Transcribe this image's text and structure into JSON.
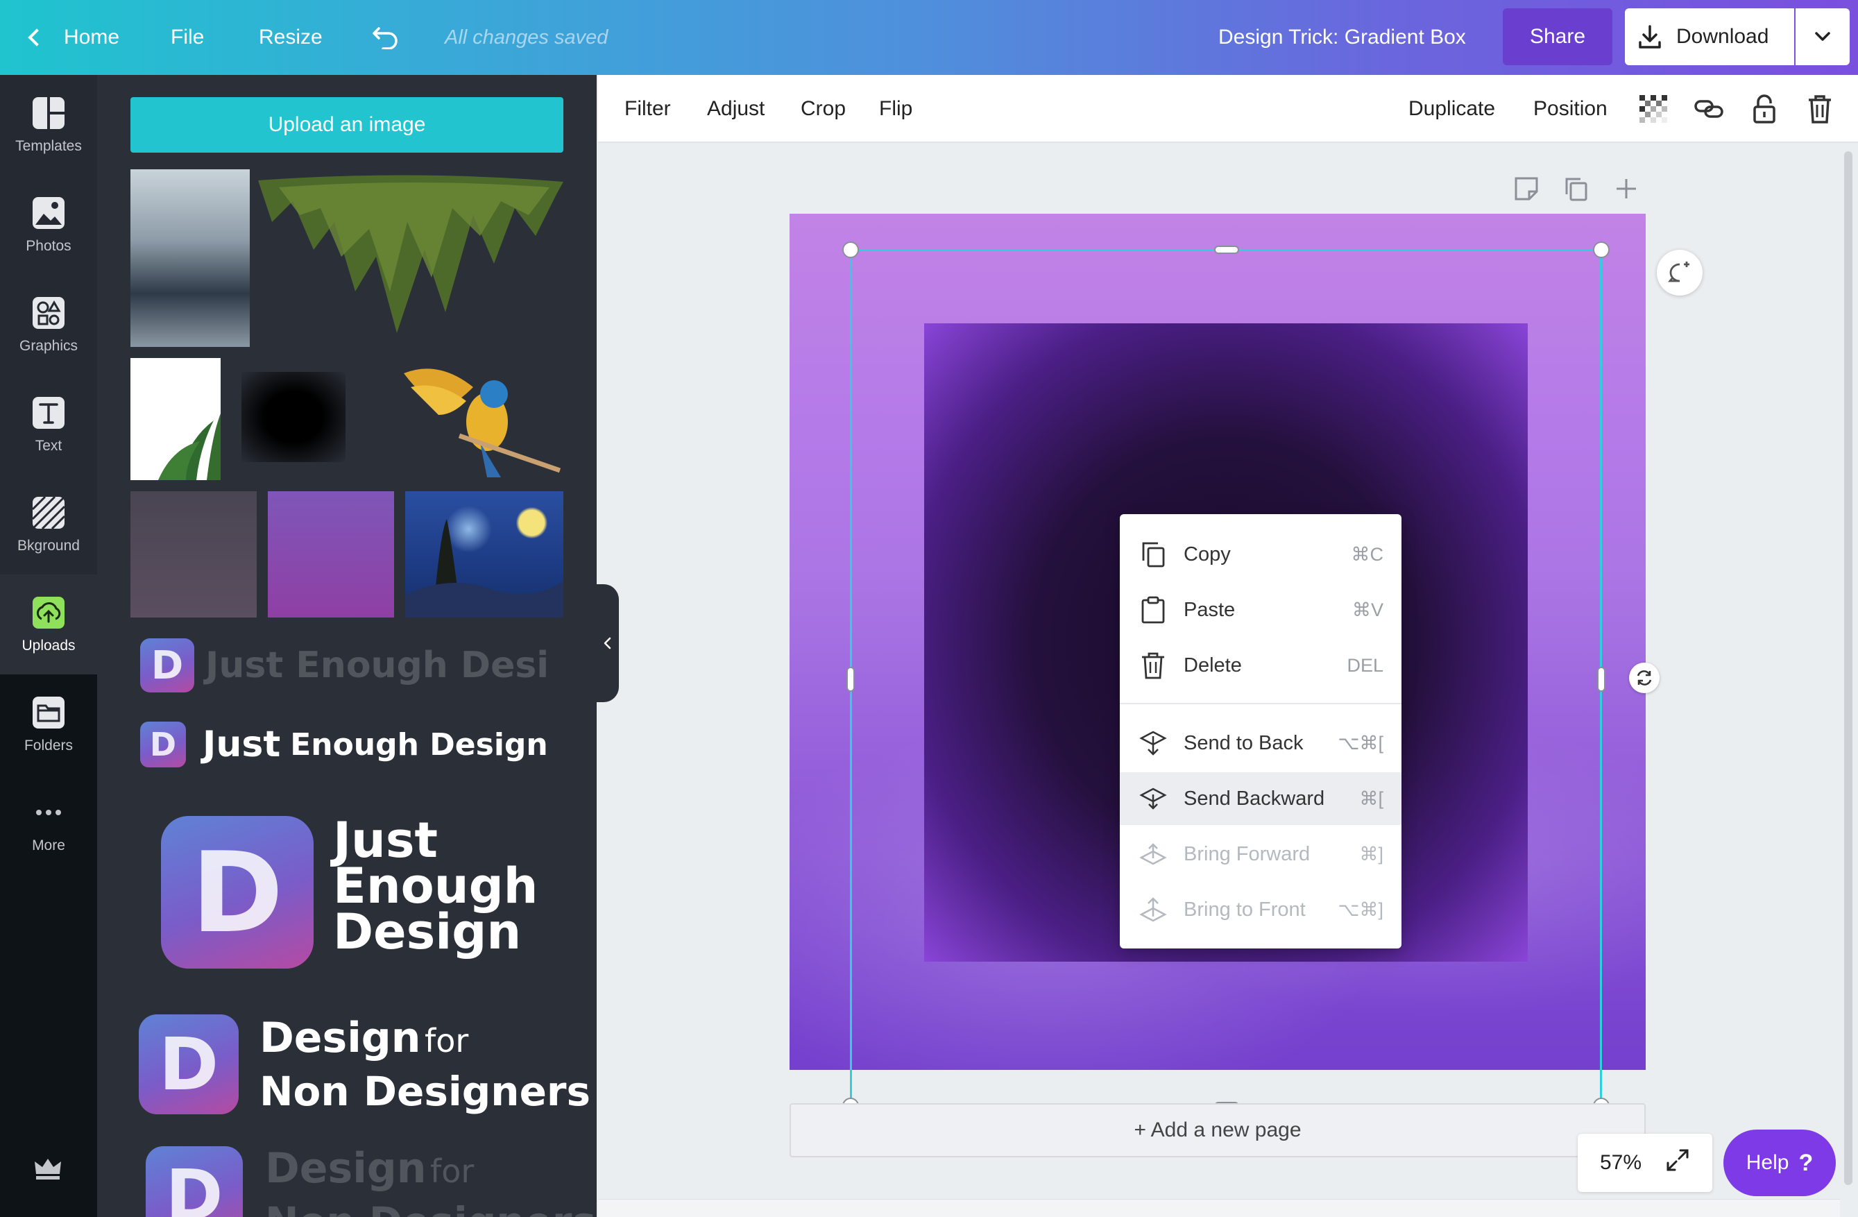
{
  "topbar": {
    "home_label": "Home",
    "file_label": "File",
    "resize_label": "Resize",
    "saved_status": "All changes saved",
    "design_title": "Design Trick: Gradient Box",
    "share_label": "Share",
    "download_label": "Download"
  },
  "rail": {
    "items": [
      {
        "label": "Templates",
        "icon": "templates-icon"
      },
      {
        "label": "Photos",
        "icon": "photos-icon"
      },
      {
        "label": "Graphics",
        "icon": "graphics-icon"
      },
      {
        "label": "Text",
        "icon": "text-icon"
      },
      {
        "label": "Bkground",
        "icon": "background-icon"
      },
      {
        "label": "Uploads",
        "icon": "uploads-icon",
        "active": true
      },
      {
        "label": "Folders",
        "icon": "folders-icon"
      },
      {
        "label": "More",
        "icon": "more-icon"
      }
    ]
  },
  "panel": {
    "upload_label": "Upload an image",
    "logos": {
      "faded_1": "Just Enough Desi",
      "row_1_just": "Just",
      "row_1_rest": "Enough Design",
      "big_line1": "Just",
      "big_line2": "Enough",
      "big_line3": "Design",
      "dfn_line1_a": "Design",
      "dfn_line1_b": "for",
      "dfn_line2": "Non Designers",
      "faded_2_a": "Design",
      "faded_2_b": "for",
      "faded_2_line2": "Non Designers",
      "logo_letter": "D"
    }
  },
  "edit_bar": {
    "filter": "Filter",
    "adjust": "Adjust",
    "crop": "Crop",
    "flip": "Flip",
    "duplicate": "Duplicate",
    "position": "Position"
  },
  "canvas": {
    "add_page_label": "+ Add a new page",
    "zoom_level": "57%"
  },
  "context_menu": {
    "items": [
      {
        "label": "Copy",
        "shortcut": "⌘C",
        "state": "enabled"
      },
      {
        "label": "Paste",
        "shortcut": "⌘V",
        "state": "enabled"
      },
      {
        "label": "Delete",
        "shortcut": "DEL",
        "state": "enabled"
      },
      {
        "label": "Send to Back",
        "shortcut": "⌥⌘[",
        "state": "enabled"
      },
      {
        "label": "Send Backward",
        "shortcut": "⌘[",
        "state": "hover"
      },
      {
        "label": "Bring Forward",
        "shortcut": "⌘]",
        "state": "disabled"
      },
      {
        "label": "Bring to Front",
        "shortcut": "⌥⌘]",
        "state": "disabled"
      }
    ]
  },
  "help": {
    "label": "Help",
    "mark": "?"
  },
  "colors": {
    "accent_teal": "#22c4cf",
    "share_purple": "#6a3fd0",
    "help_purple": "#7d3ae6",
    "selection_cyan": "#2ed0e0"
  }
}
